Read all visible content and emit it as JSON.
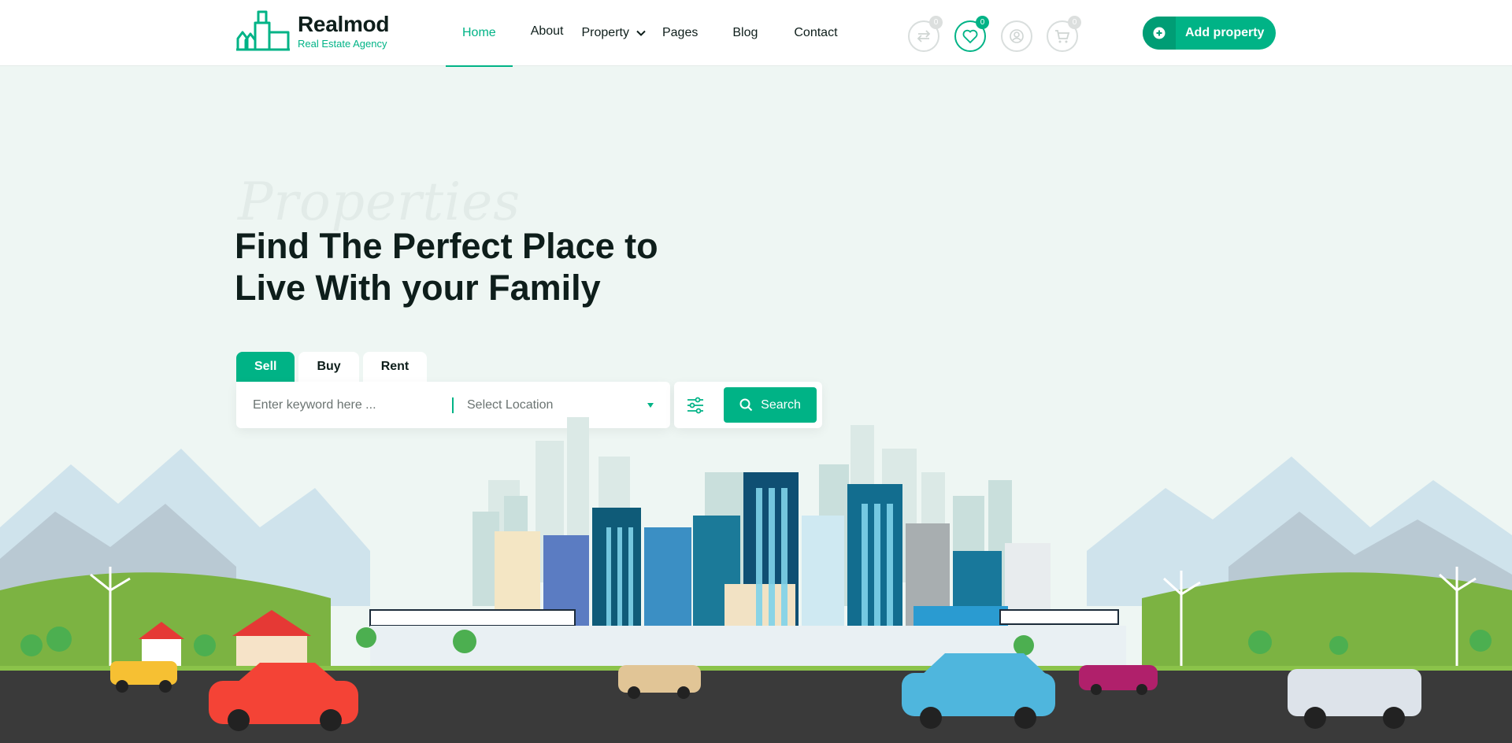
{
  "brand": {
    "name": "Realmod",
    "tagline": "Real Estate Agency"
  },
  "nav": {
    "items": [
      {
        "label": "Home",
        "active": true
      },
      {
        "label": "About"
      },
      {
        "label": "Property"
      },
      {
        "label": "Pages"
      },
      {
        "label": "Blog"
      },
      {
        "label": "Contact"
      }
    ]
  },
  "header_icons": [
    {
      "icon": "compare-icon",
      "count": "0"
    },
    {
      "icon": "heart-icon",
      "count": "0"
    },
    {
      "icon": "user-icon",
      "count": ""
    },
    {
      "icon": "cart-icon",
      "count": "0"
    }
  ],
  "add_property": {
    "label": "Add property"
  },
  "hero": {
    "script_text": "Properties",
    "title_line1": "Find The Perfect Place to",
    "title_line2": "Live With your Family"
  },
  "search": {
    "tabs": [
      "Sell",
      "Buy",
      "Rent"
    ],
    "active_tab": "Sell",
    "keyword_placeholder": "Enter keyword here ...",
    "location_label": "Select Location",
    "search_label": "Search"
  },
  "colors": {
    "accent": "#00b386",
    "dark": "#0e1e1b",
    "background": "#eef6f3"
  }
}
